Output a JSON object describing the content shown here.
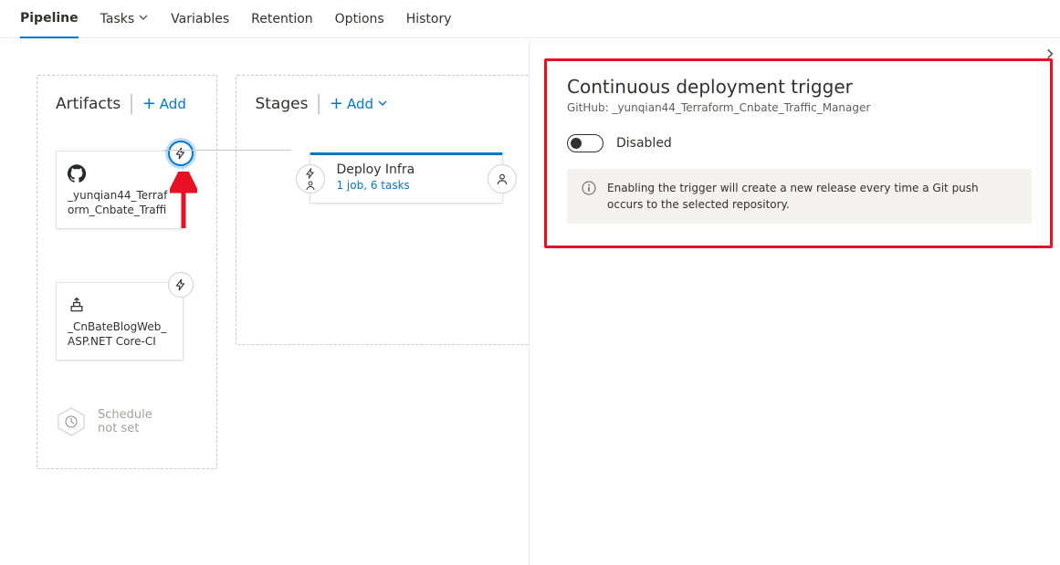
{
  "tabs": {
    "pipeline": "Pipeline",
    "tasks": "Tasks",
    "variables": "Variables",
    "retention": "Retention",
    "options": "Options",
    "history": "History"
  },
  "artifacts": {
    "title": "Artifacts",
    "add": "Add",
    "items": [
      {
        "name": "_yunqian44_Terraform_Cnbate_Traffi",
        "source_icon": "github",
        "trigger_active": true
      },
      {
        "name": "_CnBateBlogWeb_ASP.NET Core-CI",
        "source_icon": "azbuild",
        "trigger_active": false
      }
    ],
    "schedule": {
      "line1": "Schedule",
      "line2": "not set"
    }
  },
  "stages": {
    "title": "Stages",
    "add": "Add",
    "items": [
      {
        "name": "Deploy Infra",
        "jobs_tasks": "1 job, 6 tasks"
      }
    ]
  },
  "side": {
    "title": "Continuous deployment trigger",
    "subtitle_prefix": "GitHub: ",
    "subtitle_repo": "_yunqian44_Terraform_Cnbate_Traffic_Manager",
    "toggle_state": "Disabled",
    "info": "Enabling the trigger will create a new release every time a Git push occurs to the selected repository."
  }
}
